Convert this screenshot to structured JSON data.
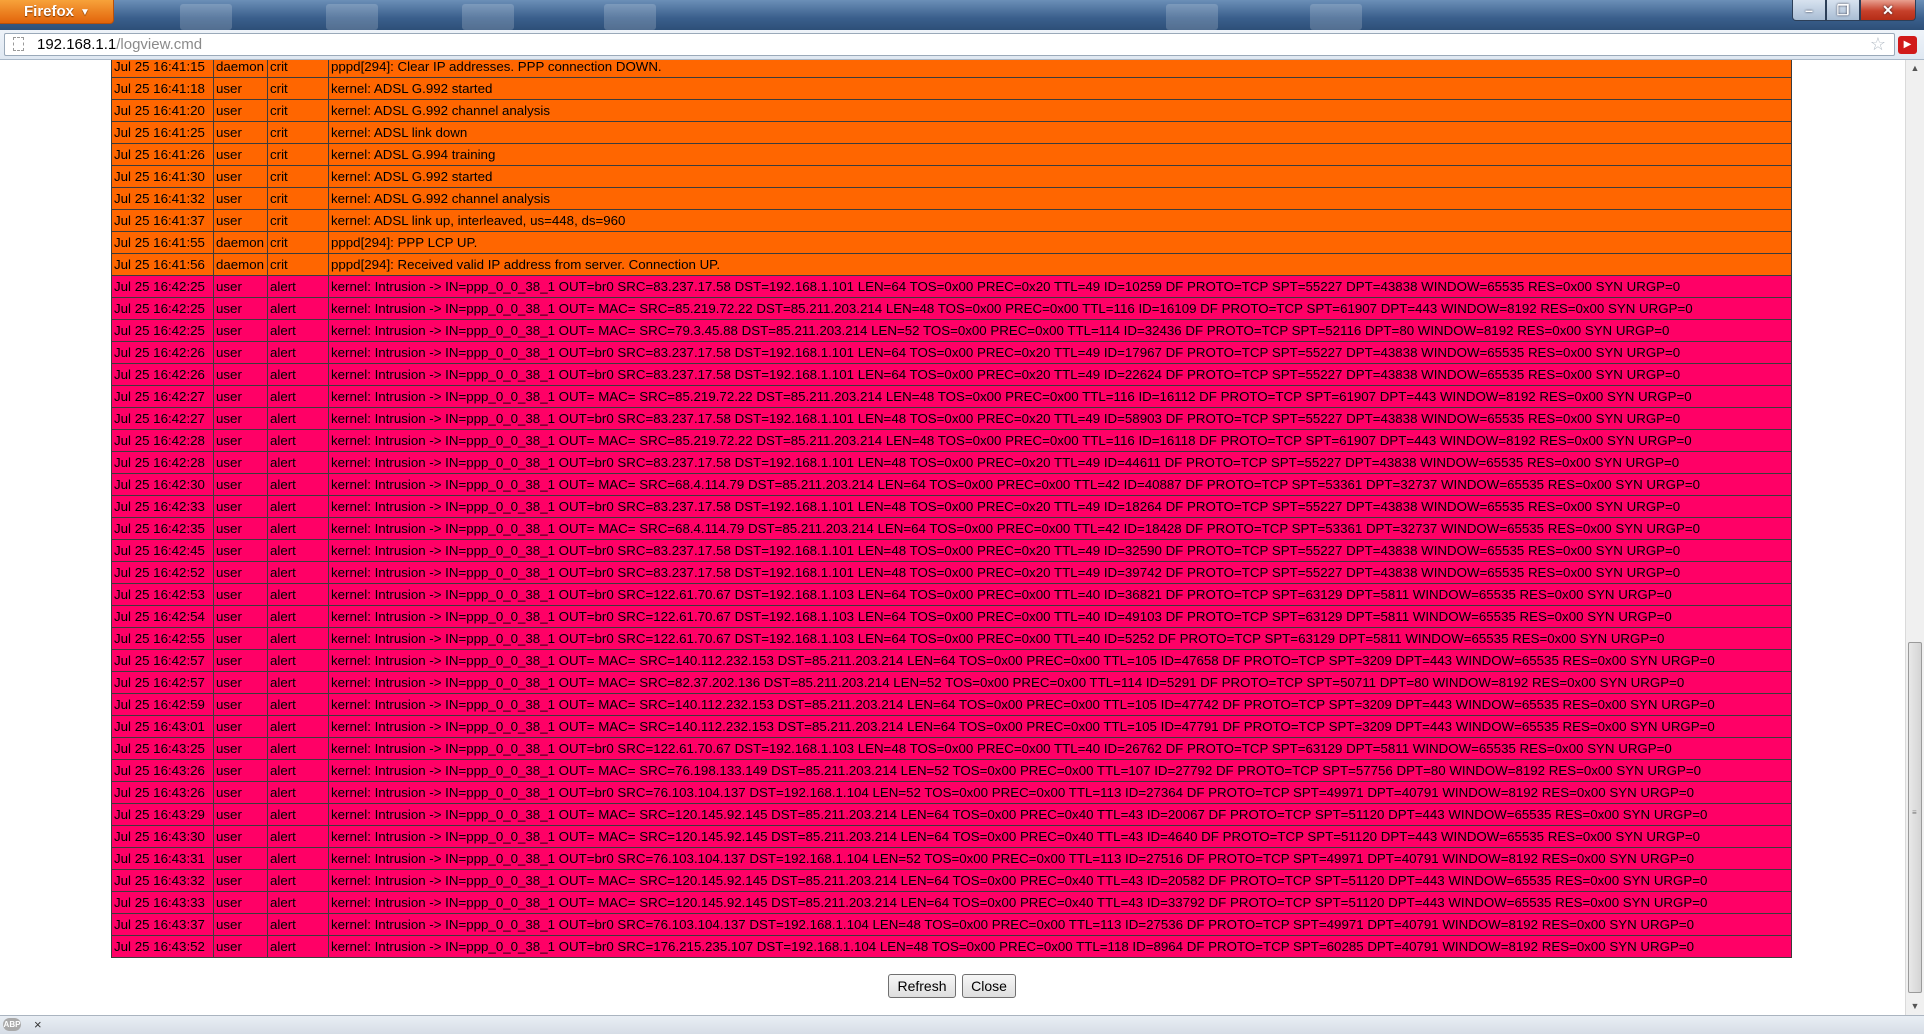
{
  "browser": {
    "menu_label": "Firefox",
    "url_host": "192.168.1.1",
    "url_path": "/logview.cmd",
    "colors": {
      "menu_button": "#e2640b",
      "close_button": "#c6402a"
    }
  },
  "log": {
    "colors": {
      "crit": "#ff6600",
      "alert": "#ff0066"
    },
    "rows": [
      {
        "date": "Jul 25 16:41:15",
        "facility": "daemon",
        "severity": "crit",
        "message": "pppd[294]: Clear IP addresses. PPP connection DOWN."
      },
      {
        "date": "Jul 25 16:41:18",
        "facility": "user",
        "severity": "crit",
        "message": "kernel: ADSL G.992 started"
      },
      {
        "date": "Jul 25 16:41:20",
        "facility": "user",
        "severity": "crit",
        "message": "kernel: ADSL G.992 channel analysis"
      },
      {
        "date": "Jul 25 16:41:25",
        "facility": "user",
        "severity": "crit",
        "message": "kernel: ADSL link down"
      },
      {
        "date": "Jul 25 16:41:26",
        "facility": "user",
        "severity": "crit",
        "message": "kernel: ADSL G.994 training"
      },
      {
        "date": "Jul 25 16:41:30",
        "facility": "user",
        "severity": "crit",
        "message": "kernel: ADSL G.992 started"
      },
      {
        "date": "Jul 25 16:41:32",
        "facility": "user",
        "severity": "crit",
        "message": "kernel: ADSL G.992 channel analysis"
      },
      {
        "date": "Jul 25 16:41:37",
        "facility": "user",
        "severity": "crit",
        "message": "kernel: ADSL link up, interleaved, us=448, ds=960"
      },
      {
        "date": "Jul 25 16:41:55",
        "facility": "daemon",
        "severity": "crit",
        "message": "pppd[294]: PPP LCP UP."
      },
      {
        "date": "Jul 25 16:41:56",
        "facility": "daemon",
        "severity": "crit",
        "message": "pppd[294]: Received valid IP address from server. Connection UP."
      },
      {
        "date": "Jul 25 16:42:25",
        "facility": "user",
        "severity": "alert",
        "message": "kernel: Intrusion -> IN=ppp_0_0_38_1 OUT=br0 SRC=83.237.17.58 DST=192.168.1.101 LEN=64 TOS=0x00 PREC=0x20 TTL=49 ID=10259 DF PROTO=TCP SPT=55227 DPT=43838 WINDOW=65535 RES=0x00 SYN URGP=0"
      },
      {
        "date": "Jul 25 16:42:25",
        "facility": "user",
        "severity": "alert",
        "message": "kernel: Intrusion -> IN=ppp_0_0_38_1 OUT= MAC= SRC=85.219.72.22 DST=85.211.203.214 LEN=48 TOS=0x00 PREC=0x00 TTL=116 ID=16109 DF PROTO=TCP SPT=61907 DPT=443 WINDOW=8192 RES=0x00 SYN URGP=0"
      },
      {
        "date": "Jul 25 16:42:25",
        "facility": "user",
        "severity": "alert",
        "message": "kernel: Intrusion -> IN=ppp_0_0_38_1 OUT= MAC= SRC=79.3.45.88 DST=85.211.203.214 LEN=52 TOS=0x00 PREC=0x00 TTL=114 ID=32436 DF PROTO=TCP SPT=52116 DPT=80 WINDOW=8192 RES=0x00 SYN URGP=0"
      },
      {
        "date": "Jul 25 16:42:26",
        "facility": "user",
        "severity": "alert",
        "message": "kernel: Intrusion -> IN=ppp_0_0_38_1 OUT=br0 SRC=83.237.17.58 DST=192.168.1.101 LEN=64 TOS=0x00 PREC=0x20 TTL=49 ID=17967 DF PROTO=TCP SPT=55227 DPT=43838 WINDOW=65535 RES=0x00 SYN URGP=0"
      },
      {
        "date": "Jul 25 16:42:26",
        "facility": "user",
        "severity": "alert",
        "message": "kernel: Intrusion -> IN=ppp_0_0_38_1 OUT=br0 SRC=83.237.17.58 DST=192.168.1.101 LEN=64 TOS=0x00 PREC=0x20 TTL=49 ID=22624 DF PROTO=TCP SPT=55227 DPT=43838 WINDOW=65535 RES=0x00 SYN URGP=0"
      },
      {
        "date": "Jul 25 16:42:27",
        "facility": "user",
        "severity": "alert",
        "message": "kernel: Intrusion -> IN=ppp_0_0_38_1 OUT= MAC= SRC=85.219.72.22 DST=85.211.203.214 LEN=48 TOS=0x00 PREC=0x00 TTL=116 ID=16112 DF PROTO=TCP SPT=61907 DPT=443 WINDOW=8192 RES=0x00 SYN URGP=0"
      },
      {
        "date": "Jul 25 16:42:27",
        "facility": "user",
        "severity": "alert",
        "message": "kernel: Intrusion -> IN=ppp_0_0_38_1 OUT=br0 SRC=83.237.17.58 DST=192.168.1.101 LEN=48 TOS=0x00 PREC=0x20 TTL=49 ID=58903 DF PROTO=TCP SPT=55227 DPT=43838 WINDOW=65535 RES=0x00 SYN URGP=0"
      },
      {
        "date": "Jul 25 16:42:28",
        "facility": "user",
        "severity": "alert",
        "message": "kernel: Intrusion -> IN=ppp_0_0_38_1 OUT= MAC= SRC=85.219.72.22 DST=85.211.203.214 LEN=48 TOS=0x00 PREC=0x00 TTL=116 ID=16118 DF PROTO=TCP SPT=61907 DPT=443 WINDOW=8192 RES=0x00 SYN URGP=0"
      },
      {
        "date": "Jul 25 16:42:28",
        "facility": "user",
        "severity": "alert",
        "message": "kernel: Intrusion -> IN=ppp_0_0_38_1 OUT=br0 SRC=83.237.17.58 DST=192.168.1.101 LEN=48 TOS=0x00 PREC=0x20 TTL=49 ID=44611 DF PROTO=TCP SPT=55227 DPT=43838 WINDOW=65535 RES=0x00 SYN URGP=0"
      },
      {
        "date": "Jul 25 16:42:30",
        "facility": "user",
        "severity": "alert",
        "message": "kernel: Intrusion -> IN=ppp_0_0_38_1 OUT= MAC= SRC=68.4.114.79 DST=85.211.203.214 LEN=64 TOS=0x00 PREC=0x00 TTL=42 ID=40887 DF PROTO=TCP SPT=53361 DPT=32737 WINDOW=65535 RES=0x00 SYN URGP=0"
      },
      {
        "date": "Jul 25 16:42:33",
        "facility": "user",
        "severity": "alert",
        "message": "kernel: Intrusion -> IN=ppp_0_0_38_1 OUT=br0 SRC=83.237.17.58 DST=192.168.1.101 LEN=48 TOS=0x00 PREC=0x20 TTL=49 ID=18264 DF PROTO=TCP SPT=55227 DPT=43838 WINDOW=65535 RES=0x00 SYN URGP=0"
      },
      {
        "date": "Jul 25 16:42:35",
        "facility": "user",
        "severity": "alert",
        "message": "kernel: Intrusion -> IN=ppp_0_0_38_1 OUT= MAC= SRC=68.4.114.79 DST=85.211.203.214 LEN=64 TOS=0x00 PREC=0x00 TTL=42 ID=18428 DF PROTO=TCP SPT=53361 DPT=32737 WINDOW=65535 RES=0x00 SYN URGP=0"
      },
      {
        "date": "Jul 25 16:42:45",
        "facility": "user",
        "severity": "alert",
        "message": "kernel: Intrusion -> IN=ppp_0_0_38_1 OUT=br0 SRC=83.237.17.58 DST=192.168.1.101 LEN=48 TOS=0x00 PREC=0x20 TTL=49 ID=32590 DF PROTO=TCP SPT=55227 DPT=43838 WINDOW=65535 RES=0x00 SYN URGP=0"
      },
      {
        "date": "Jul 25 16:42:52",
        "facility": "user",
        "severity": "alert",
        "message": "kernel: Intrusion -> IN=ppp_0_0_38_1 OUT=br0 SRC=83.237.17.58 DST=192.168.1.101 LEN=48 TOS=0x00 PREC=0x20 TTL=49 ID=39742 DF PROTO=TCP SPT=55227 DPT=43838 WINDOW=65535 RES=0x00 SYN URGP=0"
      },
      {
        "date": "Jul 25 16:42:53",
        "facility": "user",
        "severity": "alert",
        "message": "kernel: Intrusion -> IN=ppp_0_0_38_1 OUT=br0 SRC=122.61.70.67 DST=192.168.1.103 LEN=64 TOS=0x00 PREC=0x00 TTL=40 ID=36821 DF PROTO=TCP SPT=63129 DPT=5811 WINDOW=65535 RES=0x00 SYN URGP=0"
      },
      {
        "date": "Jul 25 16:42:54",
        "facility": "user",
        "severity": "alert",
        "message": "kernel: Intrusion -> IN=ppp_0_0_38_1 OUT=br0 SRC=122.61.70.67 DST=192.168.1.103 LEN=64 TOS=0x00 PREC=0x00 TTL=40 ID=49103 DF PROTO=TCP SPT=63129 DPT=5811 WINDOW=65535 RES=0x00 SYN URGP=0"
      },
      {
        "date": "Jul 25 16:42:55",
        "facility": "user",
        "severity": "alert",
        "message": "kernel: Intrusion -> IN=ppp_0_0_38_1 OUT=br0 SRC=122.61.70.67 DST=192.168.1.103 LEN=64 TOS=0x00 PREC=0x00 TTL=40 ID=5252 DF PROTO=TCP SPT=63129 DPT=5811 WINDOW=65535 RES=0x00 SYN URGP=0"
      },
      {
        "date": "Jul 25 16:42:57",
        "facility": "user",
        "severity": "alert",
        "message": "kernel: Intrusion -> IN=ppp_0_0_38_1 OUT= MAC= SRC=140.112.232.153 DST=85.211.203.214 LEN=64 TOS=0x00 PREC=0x00 TTL=105 ID=47658 DF PROTO=TCP SPT=3209 DPT=443 WINDOW=65535 RES=0x00 SYN URGP=0"
      },
      {
        "date": "Jul 25 16:42:57",
        "facility": "user",
        "severity": "alert",
        "message": "kernel: Intrusion -> IN=ppp_0_0_38_1 OUT= MAC= SRC=82.37.202.136 DST=85.211.203.214 LEN=52 TOS=0x00 PREC=0x00 TTL=114 ID=5291 DF PROTO=TCP SPT=50711 DPT=80 WINDOW=8192 RES=0x00 SYN URGP=0"
      },
      {
        "date": "Jul 25 16:42:59",
        "facility": "user",
        "severity": "alert",
        "message": "kernel: Intrusion -> IN=ppp_0_0_38_1 OUT= MAC= SRC=140.112.232.153 DST=85.211.203.214 LEN=64 TOS=0x00 PREC=0x00 TTL=105 ID=47742 DF PROTO=TCP SPT=3209 DPT=443 WINDOW=65535 RES=0x00 SYN URGP=0"
      },
      {
        "date": "Jul 25 16:43:01",
        "facility": "user",
        "severity": "alert",
        "message": "kernel: Intrusion -> IN=ppp_0_0_38_1 OUT= MAC= SRC=140.112.232.153 DST=85.211.203.214 LEN=64 TOS=0x00 PREC=0x00 TTL=105 ID=47791 DF PROTO=TCP SPT=3209 DPT=443 WINDOW=65535 RES=0x00 SYN URGP=0"
      },
      {
        "date": "Jul 25 16:43:25",
        "facility": "user",
        "severity": "alert",
        "message": "kernel: Intrusion -> IN=ppp_0_0_38_1 OUT=br0 SRC=122.61.70.67 DST=192.168.1.103 LEN=48 TOS=0x00 PREC=0x00 TTL=40 ID=26762 DF PROTO=TCP SPT=63129 DPT=5811 WINDOW=65535 RES=0x00 SYN URGP=0"
      },
      {
        "date": "Jul 25 16:43:26",
        "facility": "user",
        "severity": "alert",
        "message": "kernel: Intrusion -> IN=ppp_0_0_38_1 OUT= MAC= SRC=76.198.133.149 DST=85.211.203.214 LEN=52 TOS=0x00 PREC=0x00 TTL=107 ID=27792 DF PROTO=TCP SPT=57756 DPT=80 WINDOW=8192 RES=0x00 SYN URGP=0"
      },
      {
        "date": "Jul 25 16:43:26",
        "facility": "user",
        "severity": "alert",
        "message": "kernel: Intrusion -> IN=ppp_0_0_38_1 OUT=br0 SRC=76.103.104.137 DST=192.168.1.104 LEN=52 TOS=0x00 PREC=0x00 TTL=113 ID=27364 DF PROTO=TCP SPT=49971 DPT=40791 WINDOW=8192 RES=0x00 SYN URGP=0"
      },
      {
        "date": "Jul 25 16:43:29",
        "facility": "user",
        "severity": "alert",
        "message": "kernel: Intrusion -> IN=ppp_0_0_38_1 OUT= MAC= SRC=120.145.92.145 DST=85.211.203.214 LEN=64 TOS=0x00 PREC=0x40 TTL=43 ID=20067 DF PROTO=TCP SPT=51120 DPT=443 WINDOW=65535 RES=0x00 SYN URGP=0"
      },
      {
        "date": "Jul 25 16:43:30",
        "facility": "user",
        "severity": "alert",
        "message": "kernel: Intrusion -> IN=ppp_0_0_38_1 OUT= MAC= SRC=120.145.92.145 DST=85.211.203.214 LEN=64 TOS=0x00 PREC=0x40 TTL=43 ID=4640 DF PROTO=TCP SPT=51120 DPT=443 WINDOW=65535 RES=0x00 SYN URGP=0"
      },
      {
        "date": "Jul 25 16:43:31",
        "facility": "user",
        "severity": "alert",
        "message": "kernel: Intrusion -> IN=ppp_0_0_38_1 OUT=br0 SRC=76.103.104.137 DST=192.168.1.104 LEN=52 TOS=0x00 PREC=0x00 TTL=113 ID=27516 DF PROTO=TCP SPT=49971 DPT=40791 WINDOW=8192 RES=0x00 SYN URGP=0"
      },
      {
        "date": "Jul 25 16:43:32",
        "facility": "user",
        "severity": "alert",
        "message": "kernel: Intrusion -> IN=ppp_0_0_38_1 OUT= MAC= SRC=120.145.92.145 DST=85.211.203.214 LEN=64 TOS=0x00 PREC=0x40 TTL=43 ID=20582 DF PROTO=TCP SPT=51120 DPT=443 WINDOW=65535 RES=0x00 SYN URGP=0"
      },
      {
        "date": "Jul 25 16:43:33",
        "facility": "user",
        "severity": "alert",
        "message": "kernel: Intrusion -> IN=ppp_0_0_38_1 OUT= MAC= SRC=120.145.92.145 DST=85.211.203.214 LEN=64 TOS=0x00 PREC=0x40 TTL=43 ID=33792 DF PROTO=TCP SPT=51120 DPT=443 WINDOW=65535 RES=0x00 SYN URGP=0"
      },
      {
        "date": "Jul 25 16:43:37",
        "facility": "user",
        "severity": "alert",
        "message": "kernel: Intrusion -> IN=ppp_0_0_38_1 OUT=br0 SRC=76.103.104.137 DST=192.168.1.104 LEN=48 TOS=0x00 PREC=0x00 TTL=113 ID=27536 DF PROTO=TCP SPT=49971 DPT=40791 WINDOW=8192 RES=0x00 SYN URGP=0"
      },
      {
        "date": "Jul 25 16:43:52",
        "facility": "user",
        "severity": "alert",
        "message": "kernel: Intrusion -> IN=ppp_0_0_38_1 OUT=br0 SRC=176.215.235.107 DST=192.168.1.104 LEN=48 TOS=0x00 PREC=0x00 TTL=118 ID=8964 DF PROTO=TCP SPT=60285 DPT=40791 WINDOW=8192 RES=0x00 SYN URGP=0"
      }
    ]
  },
  "buttons": {
    "refresh": "Refresh",
    "close": "Close"
  },
  "addon_bar": {
    "abp_label": "ABP",
    "close_glyph": "×"
  }
}
